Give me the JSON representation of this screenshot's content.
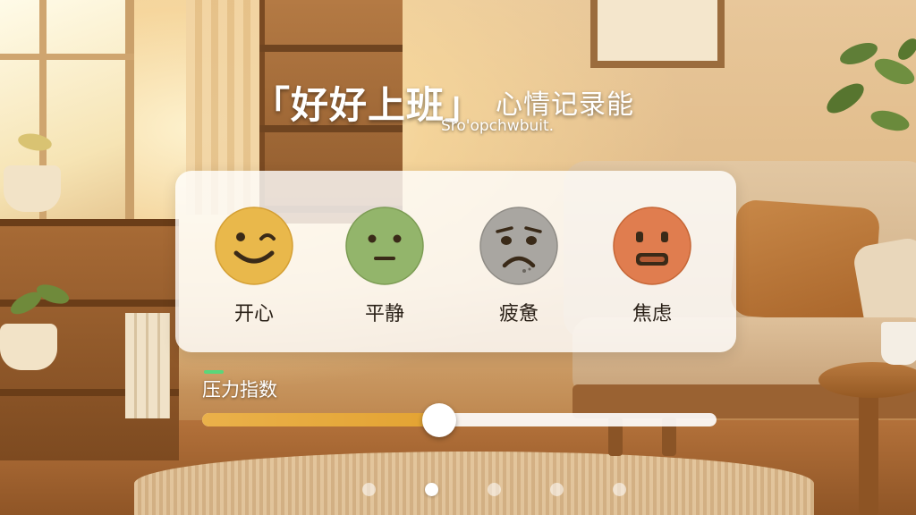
{
  "header": {
    "title": "「好好上班」",
    "subtitle": "心情记录能",
    "tagline": "Sro'opchwbuit."
  },
  "moods": [
    {
      "label": "开心",
      "icon": "happy-face-icon",
      "color": "#e9b84b"
    },
    {
      "label": "平静",
      "icon": "calm-face-icon",
      "color": "#93b56b"
    },
    {
      "label": "疲惫",
      "icon": "tired-face-icon",
      "color": "#a9a6a1"
    },
    {
      "label": "焦虑",
      "icon": "anxious-face-icon",
      "color": "#e07d4f"
    }
  ],
  "pressure": {
    "label": "压力指数",
    "value": 0.46
  },
  "pagination": {
    "count": 5,
    "active_index": 1
  },
  "colors": {
    "accent": "#e9b04a",
    "indicator": "#5bd67a"
  }
}
